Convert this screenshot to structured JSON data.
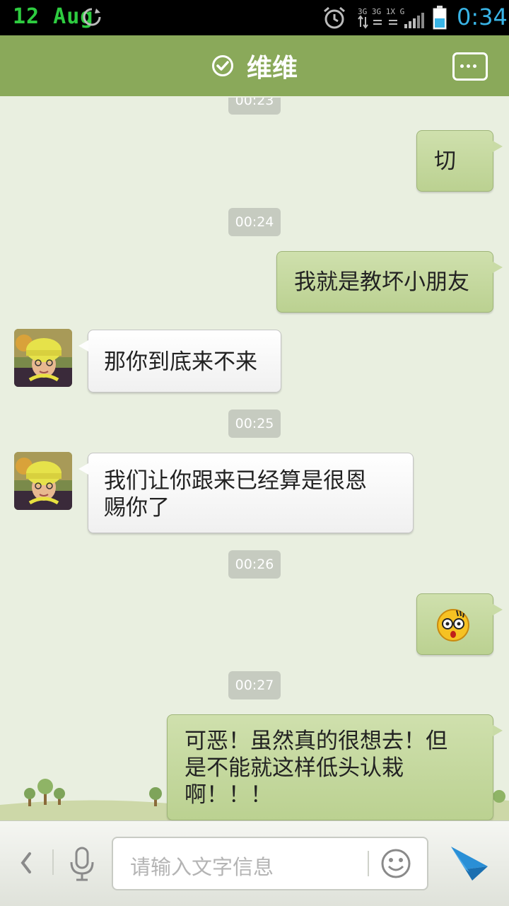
{
  "status_bar": {
    "date": "12 Aug",
    "time": "0:34",
    "network": "3G 3G 1X G",
    "icons": [
      "sync-icon",
      "alarm-icon",
      "signal-icon",
      "battery-icon"
    ]
  },
  "header": {
    "title": "维维",
    "online_icon": "check-circle-icon",
    "menu_icon": "more-icon",
    "color": "#8aa95a"
  },
  "messages": {
    "ts0": "00:23",
    "m1": "切",
    "ts1": "00:24",
    "m2": "我就是教坏小朋友",
    "m3": "那你到底来不来",
    "ts2": "00:25",
    "m4_line1": "我们让你跟来已经算是很恩",
    "m4_line2": "赐你了",
    "ts3": "00:26",
    "m5_emoji": "shocked-emoji",
    "ts4": "00:27",
    "m6_line1": "可恶！虽然真的很想去！但",
    "m6_line2": "是不能就这样低头认栽",
    "m6_line3": "啊！！！"
  },
  "input_bar": {
    "placeholder": "请输入文字信息",
    "icons": [
      "back-arrow-icon",
      "mic-icon",
      "emoji-icon",
      "send-icon"
    ]
  },
  "colors": {
    "bubble_sent": "#c4d79e",
    "bubble_received": "#f7f7f7",
    "timestamp_bg": "#c6cbc0",
    "send_blue": "#2a8fd6"
  }
}
